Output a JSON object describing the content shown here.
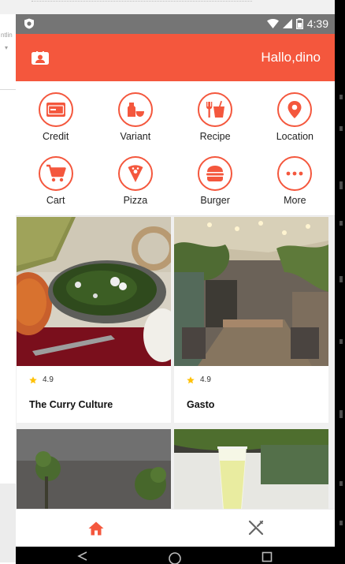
{
  "status_bar": {
    "time": "4:39"
  },
  "header": {
    "greeting": "Hallo,dino"
  },
  "categories": [
    {
      "label": "Credit",
      "icon": "credit-card-icon"
    },
    {
      "label": "Variant",
      "icon": "variant-icon"
    },
    {
      "label": "Recipe",
      "icon": "recipe-icon"
    },
    {
      "label": "Location",
      "icon": "location-pin-icon"
    },
    {
      "label": "Cart",
      "icon": "cart-icon"
    },
    {
      "label": "Pizza",
      "icon": "pizza-icon"
    },
    {
      "label": "Burger",
      "icon": "burger-icon"
    },
    {
      "label": "More",
      "icon": "more-icon"
    }
  ],
  "restaurants": [
    {
      "name": "The Curry Culture",
      "rating": "4.9"
    },
    {
      "name": "Gasto",
      "rating": "4.9"
    }
  ],
  "colors": {
    "accent": "#f4573d",
    "status_bar": "#757575",
    "star": "#ffc107"
  }
}
